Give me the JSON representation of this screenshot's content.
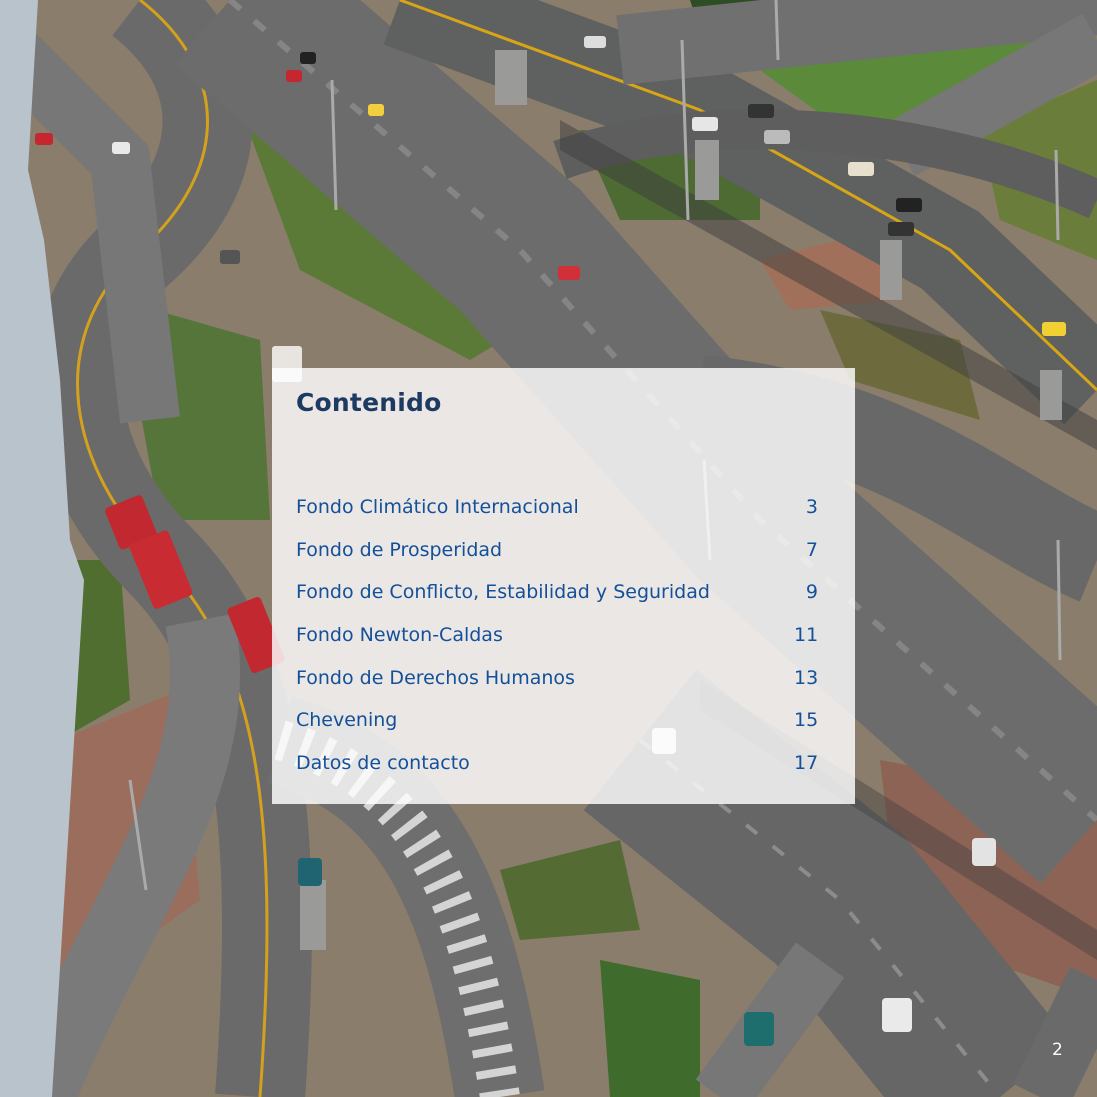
{
  "contents": {
    "title": "Contenido",
    "items": [
      {
        "label": "Fondo Climático Internacional",
        "page": "3"
      },
      {
        "label": "Fondo de Prosperidad",
        "page": "7"
      },
      {
        "label": "Fondo de Conflicto, Estabilidad y Seguridad",
        "page": "9"
      },
      {
        "label": "Fondo Newton-Caldas",
        "page": "11"
      },
      {
        "label": "Fondo de Derechos Humanos",
        "page": "13"
      },
      {
        "label": "Chevening",
        "page": "15"
      },
      {
        "label": "Datos de contacto",
        "page": "17"
      }
    ]
  },
  "page_number": "2",
  "colors": {
    "title": "#1d3a63",
    "entries": "#14509a",
    "side_band": "#b9c3cc"
  }
}
